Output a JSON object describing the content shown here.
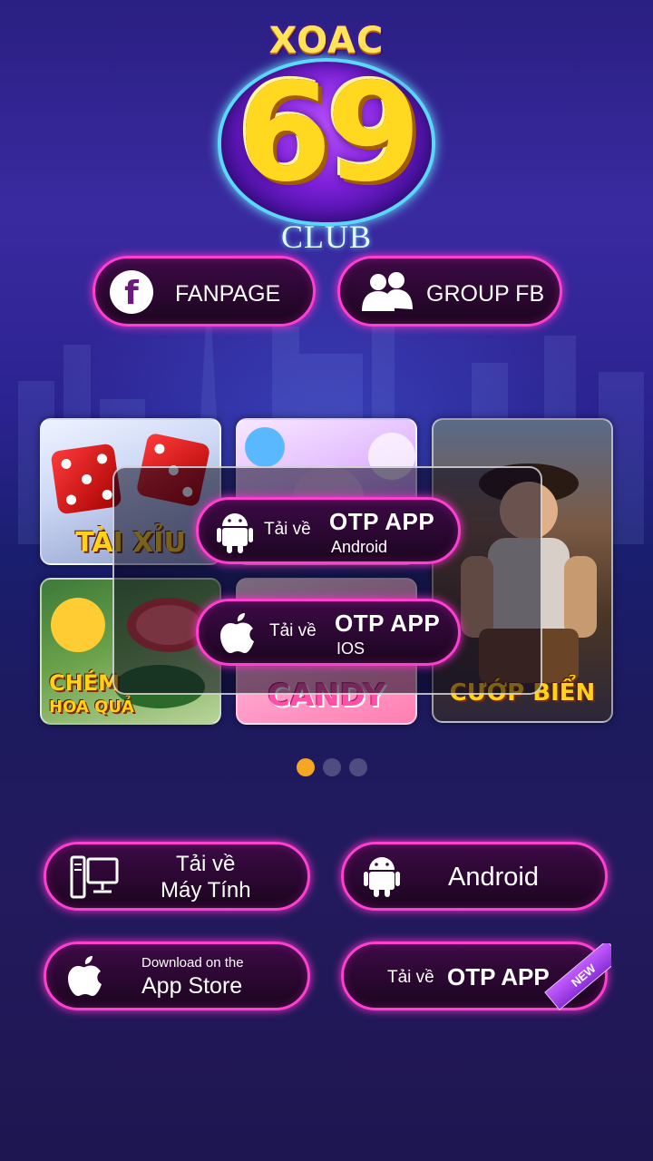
{
  "logo": {
    "top": "XOAC",
    "number": "69",
    "bottom": "CLUB"
  },
  "social": {
    "fanpage_label": "FANPAGE",
    "groupfb_label": "GROUP FB"
  },
  "games": [
    {
      "title": "TÀI XỈU"
    },
    {
      "title": "CANDY"
    },
    {
      "title": "CƯỚP BIỂN"
    },
    {
      "title_line1": "CHÉM",
      "title_line2": "HOA QUẢ"
    }
  ],
  "otp_popup": {
    "android": {
      "prefix": "Tải về",
      "main": "OTP APP",
      "sub": "Android"
    },
    "ios": {
      "prefix": "Tải về",
      "main": "OTP APP",
      "sub": "IOS"
    }
  },
  "carousel": {
    "active_index": 0,
    "count": 3
  },
  "downloads": {
    "pc_line1": "Tải về",
    "pc_line2": "Máy Tính",
    "android_label": "Android",
    "appstore_small": "Download on the",
    "appstore_big": "App Store",
    "otp_prefix": "Tải về",
    "otp_main": "OTP APP",
    "new_badge": "NEW"
  },
  "colors": {
    "accent_border": "#ff3fd1",
    "dot_active": "#f5a623",
    "dot_inactive": "#5a5a8a"
  }
}
